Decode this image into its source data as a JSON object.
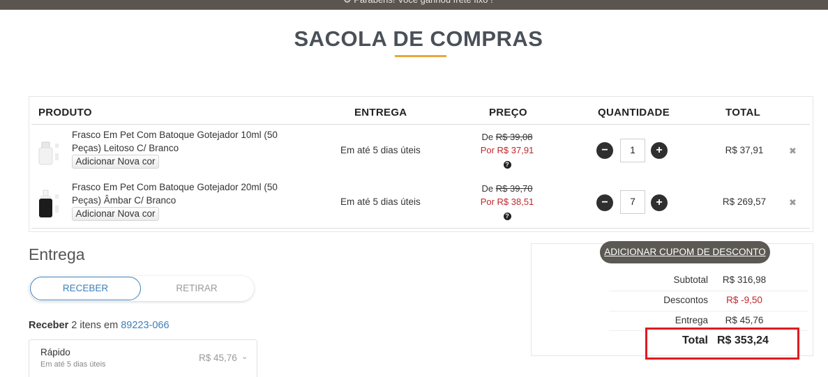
{
  "banner": {
    "text": "⚙ Parabéns! Você ganhou frete fixo !"
  },
  "page": {
    "title": "SACOLA DE COMPRAS"
  },
  "cart": {
    "headers": {
      "product": "PRODUTO",
      "delivery": "ENTREGA",
      "price": "PREÇO",
      "quantity": "QUANTIDADE",
      "total": "TOTAL"
    },
    "items": [
      {
        "name": "Frasco Em Pet Com Batoque Gotejador 10ml (50 Peças) Leitoso C/ Branco",
        "add_color_label": "Adicionar Nova cor",
        "delivery": "Em até 5 dias úteis",
        "price_old_label": "De",
        "price_old": "R$ 39,08",
        "price_new": "Por R$ 37,91",
        "quantity": "1",
        "total": "R$ 37,91",
        "thumb_color": "#f2f2f2"
      },
      {
        "name": "Frasco Em Pet Com Batoque Gotejador 20ml (50 Peças) Âmbar C/ Branco",
        "add_color_label": "Adicionar Nova cor",
        "delivery": "Em até 5 dias úteis",
        "price_old_label": "De",
        "price_old": "R$ 39,70",
        "price_new": "Por R$ 38,51",
        "quantity": "7",
        "total": "R$ 269,57",
        "thumb_color": "#1c1c1c"
      }
    ],
    "icons": {
      "help": "?",
      "minus": "−",
      "plus": "+",
      "remove": "✖"
    }
  },
  "delivery": {
    "title": "Entrega",
    "tabs": {
      "receive": "RECEBER",
      "pickup": "RETIRAR"
    },
    "receive_bold": "Receber",
    "receive_text": "2 itens em",
    "cep": "89223-066",
    "option": {
      "name": "Rápido",
      "sub": "Em até 5 dias úteis",
      "price": "R$ 45,76",
      "chevron": "⌄"
    }
  },
  "summary": {
    "coupon_label": "ADICIONAR CUPOM DE DESCONTO",
    "subtotal_label": "Subtotal",
    "subtotal": "R$ 316,98",
    "discounts_label": "Descontos",
    "discounts": "R$ -9,50",
    "shipping_label": "Entrega",
    "shipping": "R$ 45,76",
    "total_label": "Total",
    "total": "R$ 353,24"
  },
  "colors": {
    "accent_underline": "#e8a93a",
    "price_red": "#c0262c",
    "link_blue": "#3d7fb8",
    "highlight_red": "#dd1b21"
  }
}
